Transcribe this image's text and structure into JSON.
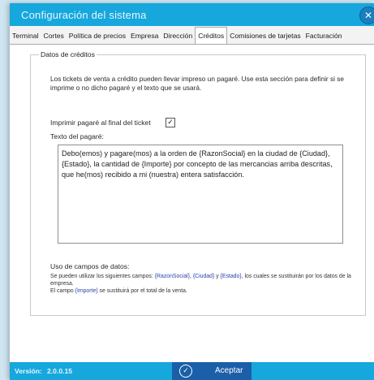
{
  "window": {
    "title": "Configuración del sistema",
    "close_icon": "close-icon"
  },
  "tabs": [
    {
      "label": "Terminal",
      "active": false
    },
    {
      "label": "Cortes",
      "active": false
    },
    {
      "label": "Política de precios",
      "active": false
    },
    {
      "label": "Empresa",
      "active": false
    },
    {
      "label": "Dirección",
      "active": false
    },
    {
      "label": "Créditos",
      "active": true
    },
    {
      "label": "Comisiones de tarjetas",
      "active": false
    },
    {
      "label": "Facturación",
      "active": false
    }
  ],
  "credit": {
    "group_title": "Datos de créditos",
    "description": "Los tickets de venta a crédito pueden llevar impreso un pagaré. Use esta sección para definir si se imprime o no dicho pagaré y el texto que se usará.",
    "print_label": "Imprimir pagaré al final del ticket",
    "print_checked": true,
    "check_mark": "☑",
    "text_label": "Texto del pagaré:",
    "text_value": "Debo(emos) y pagare(mos) a la orden de {RazonSocial} en la ciudad de {Ciudad}, {Estado}, la cantidad de {Importe} por concepto de las mercancias arriba descritas, que he(mos) recibido a mi (nuestra) entera satisfacción.",
    "fields_title": "Uso de campos de datos:",
    "fields_line1_pre": "Se pueden utilizar los siguientes campos: ",
    "field_razon": "{RazonSocial}",
    "sep1": ", ",
    "field_ciudad": "{Ciudad}",
    "sep2": " y ",
    "field_estado": "{Estado}",
    "fields_line1_post": ", los cuales se sustituirán por los datos de la empresa.",
    "fields_line2_pre": "El campo ",
    "field_importe": "{Importe}",
    "fields_line2_post": " se sustituirá por el total de la venta."
  },
  "footer": {
    "version_label": "Versión:",
    "version_value": "2.0.0.15",
    "accept_label": "Aceptar",
    "accept_icon": "check-circle-icon"
  },
  "colors": {
    "accent": "#16a7dd",
    "button": "#1b5fa8",
    "field_highlight": "#2b3fa8"
  }
}
